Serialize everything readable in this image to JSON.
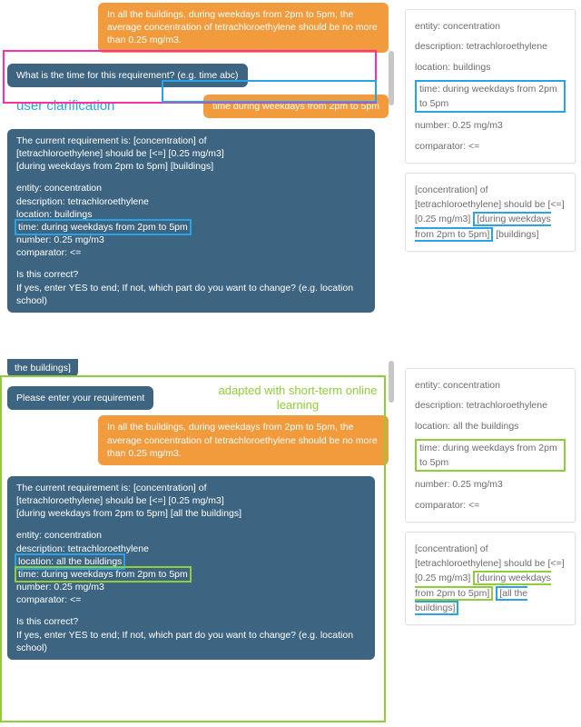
{
  "top": {
    "req_text": "In all the buildings, during weekdays from 2pm to 5pm, the average concentration of tetrachloroethylene should be no more than 0.25 mg/m3.",
    "question": "What is the time for this requirement? (e.g. time abc)",
    "clarification_label": "user clarification",
    "user_reply": "time during weekdays from 2pm to 5pm",
    "conf_l1": "The current requirement is: [concentration] of",
    "conf_l2": "[tetrachloroethylene] should be [<=] [0.25 mg/m3]",
    "conf_l3": "[during weekdays from 2pm to 5pm] [buildings]",
    "kv_entity": "entity: concentration",
    "kv_desc": "description: tetrachloroethylene",
    "kv_loc": "location: buildings",
    "kv_time": "time: during weekdays from 2pm to 5pm",
    "kv_num": "number: 0.25 mg/m3",
    "kv_cmp": "comparator: <=",
    "ask1": "Is this correct?",
    "ask2": "If yes, enter YES to end; If not, which part do you want to change? (e.g. location school)"
  },
  "top_side": {
    "kv_entity": "entity: concentration",
    "kv_desc": "description: tetrachloroethylene",
    "kv_loc": "location: buildings",
    "kv_time": "time: during weekdays from 2pm to 5pm",
    "kv_num": "number: 0.25 mg/m3",
    "kv_cmp": "comparator: <=",
    "sent_a": "[concentration] of [tetrachloroethylene] should be [<=] [0.25 mg/m3] ",
    "sent_hl": "[during weekdays from 2pm to 5pm]",
    "sent_c": " [buildings]"
  },
  "bot": {
    "prev_tail": "the buildings]",
    "prompt": "Please enter your requirement",
    "adapted_label_l1": "adapted with short-term online",
    "adapted_label_l2": "learning",
    "req_text": "In all the buildings, during weekdays from 2pm to 5pm, the average concentration of tetrachloroethylene should be no more than 0.25 mg/m3.",
    "conf_l1": "The current requirement is: [concentration] of",
    "conf_l2": "[tetrachloroethylene] should be [<=] [0.25 mg/m3]",
    "conf_l3": "[during weekdays from 2pm to 5pm] [all the buildings]",
    "kv_entity": "entity: concentration",
    "kv_desc": "description: tetrachloroethylene",
    "kv_loc": "location: all the buildings",
    "kv_time": "time: during weekdays from 2pm to 5pm",
    "kv_num": "number: 0.25 mg/m3",
    "kv_cmp": "comparator: <=",
    "ask1": "Is this correct?",
    "ask2": "If yes, enter YES to end; If not, which part do you want to change? (e.g. location school)"
  },
  "bot_side": {
    "kv_entity": "entity: concentration",
    "kv_desc": "description: tetrachloroethylene",
    "kv_loc": "location: all the buildings",
    "kv_time": "time: during weekdays from 2pm to 5pm",
    "kv_num": "number: 0.25 mg/m3",
    "kv_cmp": "comparator: <=",
    "sent_a": "[concentration] of [tetrachloroethylene] should be [<=] [0.25 mg/m3] ",
    "sent_hl1": "[during weekdays from 2pm to 5pm]",
    "sent_gap": " ",
    "sent_hl2": "[all the buildings]"
  }
}
